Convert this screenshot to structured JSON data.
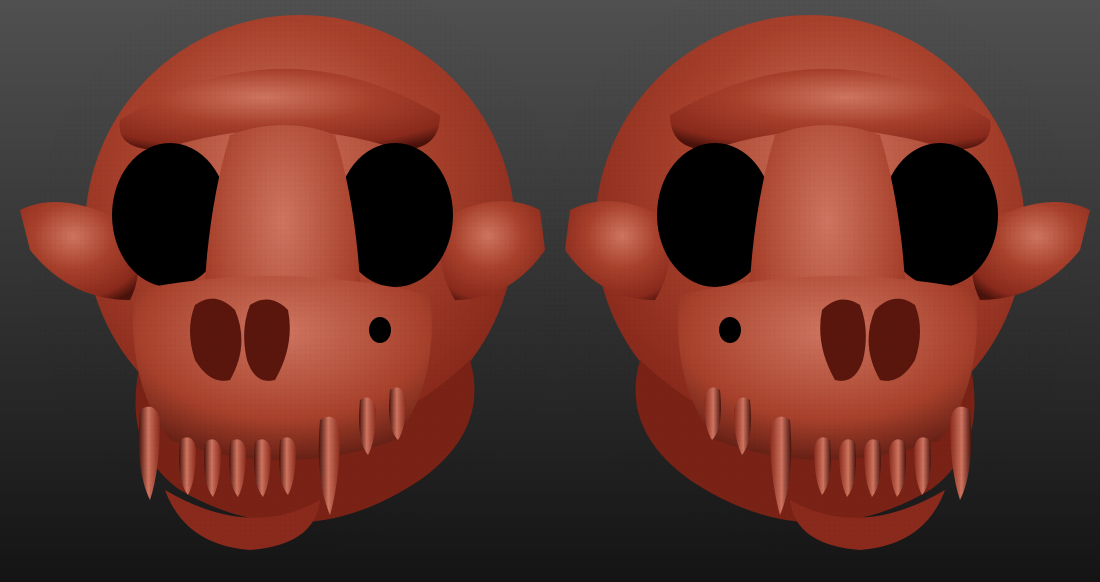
{
  "scene": {
    "subject": "",
    "colors": {
      "background_top": "#505050",
      "background_bottom": "#141414",
      "bone_base": "#8a2a1c",
      "bone_mid": "#a8412c",
      "bone_highlight": "#cf7560",
      "bone_shadow": "#4a120b",
      "cavity": "#000000"
    },
    "renders": [
      {
        "view": "front-left"
      },
      {
        "view": "front-right"
      }
    ]
  }
}
